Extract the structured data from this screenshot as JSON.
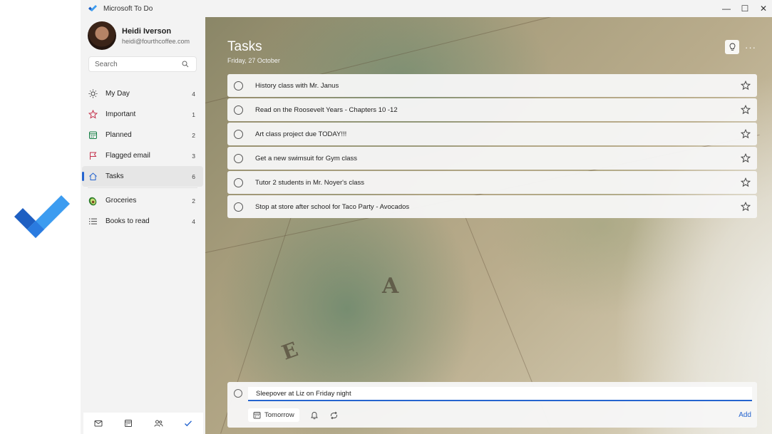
{
  "app": {
    "title": "Microsoft To Do"
  },
  "window_controls": {
    "minimize": "—",
    "maximize": "☐",
    "close": "✕"
  },
  "profile": {
    "name": "Heidi Iverson",
    "email": "heidi@fourthcoffee.com"
  },
  "search": {
    "placeholder": "Search"
  },
  "nav": [
    {
      "label": "My Day",
      "count": "4",
      "icon": "sun-icon"
    },
    {
      "label": "Important",
      "count": "1",
      "icon": "star-icon"
    },
    {
      "label": "Planned",
      "count": "2",
      "icon": "calendar-icon"
    },
    {
      "label": "Flagged email",
      "count": "3",
      "icon": "flag-icon"
    },
    {
      "label": "Tasks",
      "count": "6",
      "icon": "home-icon",
      "active": true
    }
  ],
  "lists": [
    {
      "label": "Groceries",
      "count": "2",
      "icon": "avocado-icon"
    },
    {
      "label": "Books to read",
      "count": "4",
      "icon": "list-icon"
    }
  ],
  "main": {
    "title": "Tasks",
    "date": "Friday, 27 October",
    "more": "···"
  },
  "tasks": [
    {
      "title": "History class with Mr. Janus"
    },
    {
      "title": "Read on the Roosevelt Years - Chapters 10 -12"
    },
    {
      "title": "Art class project due TODAY!!!"
    },
    {
      "title": "Get a new swimsuit for Gym class"
    },
    {
      "title": "Tutor 2 students in Mr. Noyer's class"
    },
    {
      "title": "Stop at store after school for Taco Party - Avocados"
    }
  ],
  "add_task": {
    "value": "Sleepover at Liz on Friday night",
    "due_label": "Tomorrow",
    "add_label": "Add"
  },
  "colors": {
    "accent": "#2564cf",
    "important_star": "#c4314b",
    "planned": "#107c41",
    "flag": "#c4314b"
  }
}
